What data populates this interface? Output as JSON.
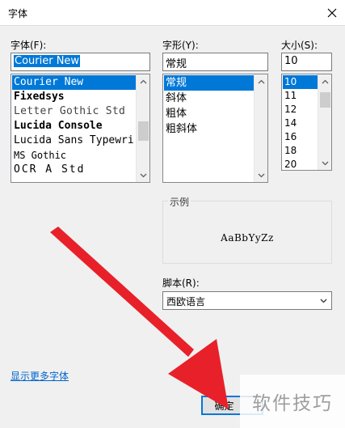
{
  "dialog": {
    "title": "字体"
  },
  "font_panel": {
    "label": "字体(F):",
    "input_value": "Courier New",
    "items": [
      {
        "label": "Courier New",
        "selected": true
      },
      {
        "label": "Fixedsys",
        "selected": false
      },
      {
        "label": "Letter Gothic Std",
        "selected": false
      },
      {
        "label": "Lucida Console",
        "selected": false
      },
      {
        "label": "Lucida Sans Typewri",
        "selected": false
      },
      {
        "label": "MS Gothic",
        "selected": false
      },
      {
        "label": "OCR A Std",
        "selected": false
      }
    ]
  },
  "style_panel": {
    "label": "字形(Y):",
    "input_value": "常规",
    "items": [
      {
        "label": "常规",
        "selected": true
      },
      {
        "label": "斜体",
        "selected": false
      },
      {
        "label": "粗体",
        "selected": false
      },
      {
        "label": "粗斜体",
        "selected": false
      }
    ]
  },
  "size_panel": {
    "label": "大小(S):",
    "input_value": "10",
    "items": [
      {
        "label": "10",
        "selected": true
      },
      {
        "label": "11",
        "selected": false
      },
      {
        "label": "12",
        "selected": false
      },
      {
        "label": "14",
        "selected": false
      },
      {
        "label": "16",
        "selected": false
      },
      {
        "label": "18",
        "selected": false
      },
      {
        "label": "20",
        "selected": false
      }
    ]
  },
  "sample": {
    "label": "示例",
    "text": "AaBbYyZz"
  },
  "script": {
    "label": "脚本(R):",
    "value": "西欧语言"
  },
  "more_fonts_link": "显示更多字体",
  "ok_button": "确定",
  "watermark": "软件技巧",
  "colors": {
    "selection": "#0078d7",
    "link": "#0066cc",
    "annotation_arrow": "#e8202a"
  }
}
